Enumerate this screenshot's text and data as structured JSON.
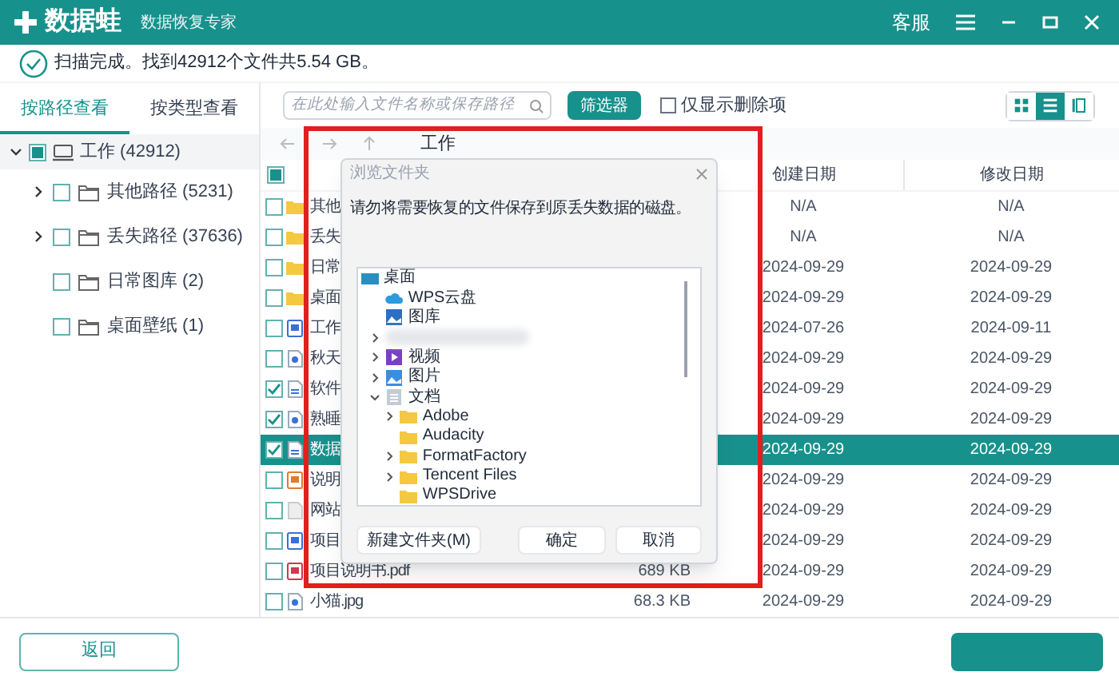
{
  "app": {
    "name": "数据蛙",
    "subtitle": "数据恢复专家",
    "service": "客服"
  },
  "status": "扫描完成。找到42912个文件共5.54 GB。",
  "sidebar": {
    "tabs": [
      {
        "label": "按路径查看",
        "selected": true
      },
      {
        "label": "按类型查看",
        "selected": false
      }
    ],
    "tree": {
      "label": "工作 (42912)",
      "checked": false,
      "indeterminate": true,
      "selected": true,
      "expanded": true,
      "children": [
        {
          "label": "其他路径 (5231)",
          "checked": false,
          "selected": false,
          "expandable": true
        },
        {
          "label": "丢失路径 (37636)",
          "checked": false,
          "selected": false,
          "expandable": true
        },
        {
          "label": "日常图库 (2)",
          "checked": false,
          "selected": false,
          "expandable": false
        },
        {
          "label": "桌面壁纸 (1)",
          "checked": false,
          "selected": false,
          "expandable": false
        }
      ]
    }
  },
  "toolbar": {
    "search_placeholder": "在此处输入文件名称或保存路径",
    "filter_button": "筛选器",
    "deleted_only": {
      "label": "仅显示删除项",
      "checked": false
    },
    "views": [
      {
        "kind": "grid",
        "selected": false
      },
      {
        "kind": "list",
        "selected": true
      },
      {
        "kind": "detail",
        "selected": false
      }
    ]
  },
  "table": {
    "location": "工作",
    "columns": [
      "创建日期",
      "修改日期"
    ],
    "header_checkbox": {
      "checked": false,
      "indeterminate": true
    },
    "rows": [
      {
        "kind": "folder",
        "name": "其他",
        "checked": false,
        "selected": false,
        "created": "N/A",
        "modified": "N/A"
      },
      {
        "kind": "folder",
        "name": "丢失",
        "checked": false,
        "selected": false,
        "created": "N/A",
        "modified": "N/A"
      },
      {
        "kind": "folder",
        "name": "日常",
        "checked": false,
        "selected": false,
        "created": "2024-09-29",
        "modified": "2024-09-29"
      },
      {
        "kind": "folder",
        "name": "桌面",
        "checked": false,
        "selected": false,
        "created": "2024-09-29",
        "modified": "2024-09-29"
      },
      {
        "kind": "word",
        "name": "工作",
        "checked": false,
        "selected": false,
        "created": "2024-07-26",
        "modified": "2024-09-11"
      },
      {
        "kind": "image",
        "name": "秋天",
        "checked": false,
        "selected": false,
        "created": "2024-09-29",
        "modified": "2024-09-29"
      },
      {
        "kind": "text",
        "name": "软件",
        "checked": true,
        "selected": false,
        "created": "2024-09-29",
        "modified": "2024-09-29"
      },
      {
        "kind": "image",
        "name": "熟睡",
        "checked": true,
        "selected": false,
        "created": "2024-09-29",
        "modified": "2024-09-29"
      },
      {
        "kind": "text",
        "name": "数据",
        "checked": true,
        "selected": true,
        "created": "2024-09-29",
        "modified": "2024-09-29"
      },
      {
        "kind": "slides",
        "name": "说明",
        "checked": false,
        "selected": false,
        "created": "2024-09-29",
        "modified": "2024-09-29"
      },
      {
        "kind": "file",
        "name": "网站",
        "checked": false,
        "selected": false,
        "created": "2024-09-29",
        "modified": "2024-09-29"
      },
      {
        "kind": "word",
        "name": "项目",
        "checked": false,
        "selected": false,
        "created": "2024-09-29",
        "modified": "2024-09-29"
      },
      {
        "kind": "pdf",
        "name": "项目说明书.pdf",
        "checked": false,
        "selected": false,
        "size": "689 KB",
        "created": "2024-09-29",
        "modified": "2024-09-29"
      },
      {
        "kind": "image",
        "name": "小猫.jpg",
        "checked": false,
        "selected": false,
        "size": "68.3 KB",
        "created": "2024-09-29",
        "modified": "2024-09-29"
      }
    ]
  },
  "dialog": {
    "title": "浏览文件夹",
    "message": "请勿将需要恢复的文件保存到原丢失数据的磁盘。",
    "tree": [
      {
        "kind": "desktop",
        "label": "桌面",
        "children": [
          {
            "kind": "cloud",
            "label": "WPS云盘"
          },
          {
            "kind": "gallery",
            "label": "图库"
          },
          {
            "kind": "redacted",
            "expanded": false
          },
          {
            "kind": "video",
            "label": "视频",
            "expanded": false
          },
          {
            "kind": "pictures",
            "label": "图片",
            "expanded": false
          },
          {
            "kind": "documents",
            "label": "文档",
            "expanded": true,
            "children": [
              {
                "kind": "folder",
                "label": "Adobe",
                "expanded": false
              },
              {
                "kind": "folder",
                "label": "Audacity"
              },
              {
                "kind": "folder",
                "label": "FormatFactory",
                "expanded": false
              },
              {
                "kind": "folder",
                "label": "Tencent Files",
                "expanded": false
              },
              {
                "kind": "folder",
                "label": "WPSDrive"
              }
            ]
          }
        ]
      }
    ],
    "buttons": [
      "新建文件夹(M)",
      "确定",
      "取消"
    ]
  },
  "back_button": "返回"
}
